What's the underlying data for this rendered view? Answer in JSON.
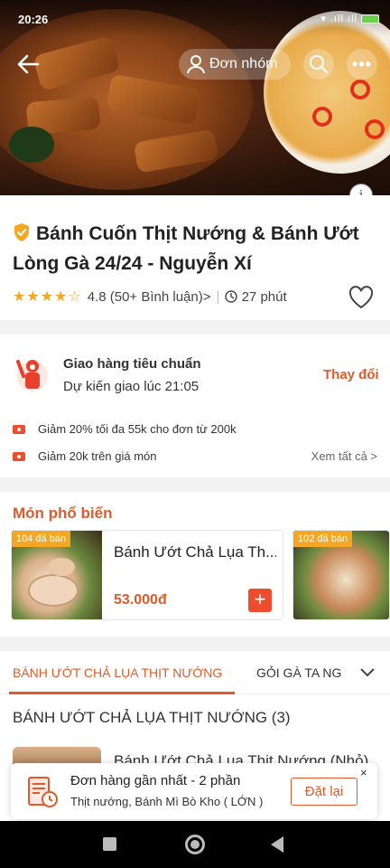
{
  "status_bar": {
    "time": "20:26",
    "right": "▾ .ıll ıll"
  },
  "header": {
    "group_order_label": "Đơn nhóm",
    "more_label": "•••",
    "info_label": "i"
  },
  "store": {
    "name": "Bánh Cuốn Thịt Nướng & Bánh Ướt Lòng Gà 24/24 - Nguyễn Xí",
    "stars": "★★★★☆",
    "rating": "4.8",
    "reviews": "(50+ Bình luận)",
    "chevron": ">",
    "separator": "|",
    "time": "27 phút"
  },
  "delivery": {
    "title": "Giao hàng tiêu chuẩn",
    "eta": "Dự kiến giao lúc 21:05",
    "change_label": "Thay đổi",
    "promos": [
      "Giảm 20% tối đa 55k cho đơn từ 200k",
      "Giảm 20k trên giá món"
    ],
    "see_all": "Xem tất cả >"
  },
  "popular": {
    "title": "Món phổ biến",
    "items": [
      {
        "sold": "104 đã bán",
        "name": "Bánh Ướt Chả Lụa Th...",
        "price": "53.000đ",
        "add": "+"
      },
      {
        "sold": "102 đã bán"
      }
    ]
  },
  "menu": {
    "tabs": [
      "BÁNH ƯỚT CHẢ LỤA THỊT NƯỚNG",
      "GỎI GÀ TA NG"
    ],
    "category_title": "BÁNH ƯỚT CHẢ LỤA THỊT NƯỚNG (3)",
    "first_dish_name": "Bánh Ướt Chả Lụa Thịt Nướng (Nhỏ)"
  },
  "recent_order": {
    "title": "Đơn hàng gần nhất - 2 phần",
    "items": "Thịt nướng, Bánh Mì Bò Kho ( LỚN )",
    "reorder_label": "Đặt lại",
    "close_label": "×"
  },
  "colors": {
    "accent": "#e05a2b",
    "star": "#f5a623",
    "badge": "#f5a623",
    "verified": "#f5a623"
  }
}
